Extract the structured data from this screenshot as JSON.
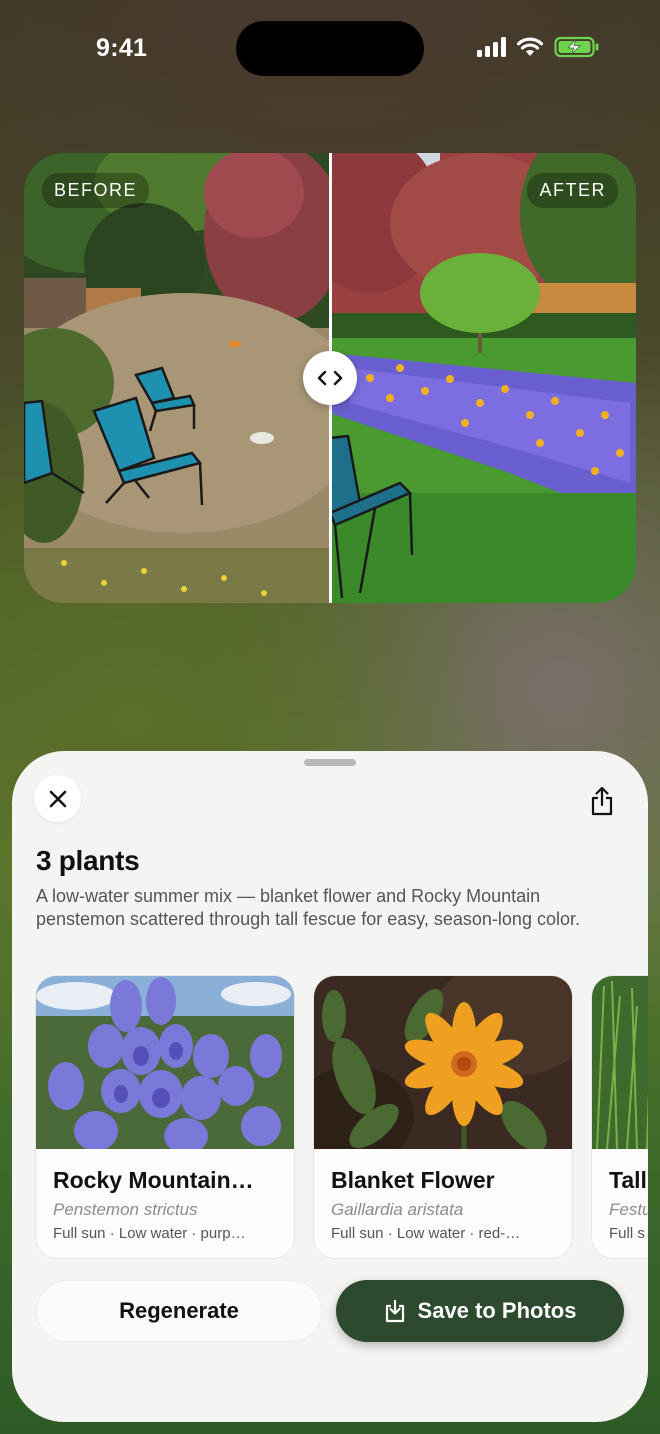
{
  "status_bar": {
    "time": "9:41"
  },
  "comparison": {
    "before_label": "BEFORE",
    "after_label": "AFTER",
    "handle_icon": "chevron-left-right-icon"
  },
  "sheet": {
    "close_icon": "close-icon",
    "share_icon": "share-icon",
    "title": "3 plants",
    "description": "A low-water summer mix — blanket flower and Rocky Mountain penstemon scattered through tall fescue for easy, season-long color.",
    "plants": [
      {
        "name": "Rocky Mountain…",
        "scientific": "Penstemon strictus",
        "meta": "Full sun · Low water · purp…"
      },
      {
        "name": "Blanket Flower",
        "scientific": "Gaillardia aristata",
        "meta": "Full sun · Low water · red-…"
      },
      {
        "name": "Tall",
        "scientific": "Festu",
        "meta": "Full s"
      }
    ],
    "regenerate_label": "Regenerate",
    "save_label": "Save to Photos",
    "save_icon": "save-download-icon"
  },
  "colors": {
    "accent": "#2e4a2e",
    "sheet_bg": "#f4f4f2"
  }
}
